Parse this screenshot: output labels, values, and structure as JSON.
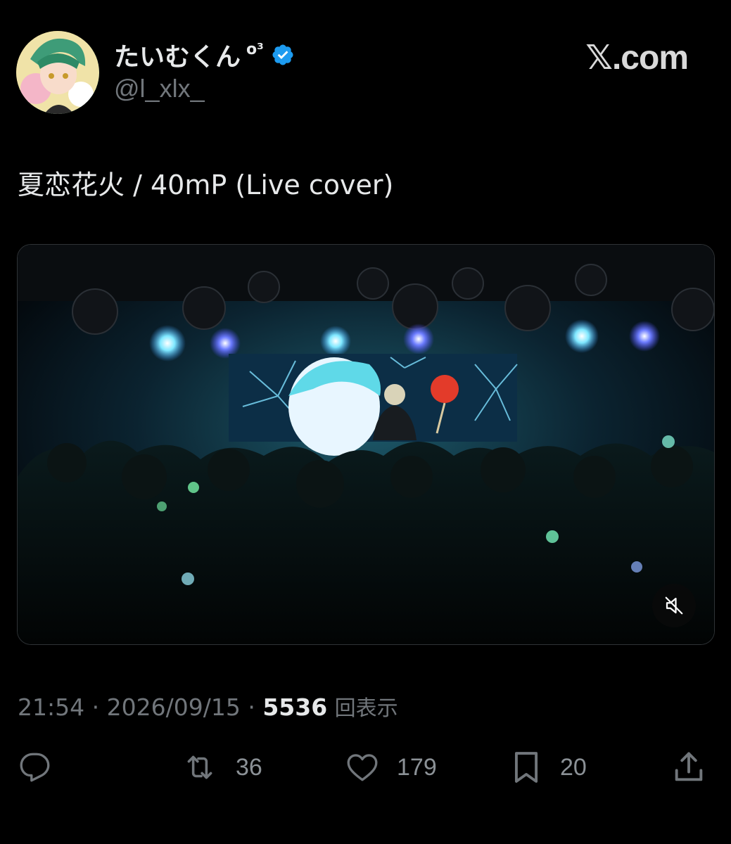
{
  "header": {
    "display_name": "たいむくん",
    "display_name_suffix": "o³",
    "handle": "@l_xlx_",
    "brand": "𝕏.com"
  },
  "post": {
    "text": "夏恋花火 / 40mP (Live cover)",
    "time": "21:54",
    "separator": "·",
    "date": "2026/09/15",
    "views": "5536",
    "views_label": "回表示"
  },
  "media": {
    "type": "video",
    "muted": true
  },
  "actions": {
    "reply_count": "",
    "retweet_count": "36",
    "like_count": "179",
    "bookmark_count": "20"
  },
  "colors": {
    "background": "#000000",
    "text_primary": "#e7e9ea",
    "text_secondary": "#71767b",
    "verified_badge": "#1d9bf0"
  },
  "icons": {
    "verified": "verified-badge-icon",
    "mute": "speaker-muted-icon",
    "reply": "reply-icon",
    "retweet": "retweet-icon",
    "like": "heart-icon",
    "bookmark": "bookmark-icon",
    "share": "share-icon"
  }
}
